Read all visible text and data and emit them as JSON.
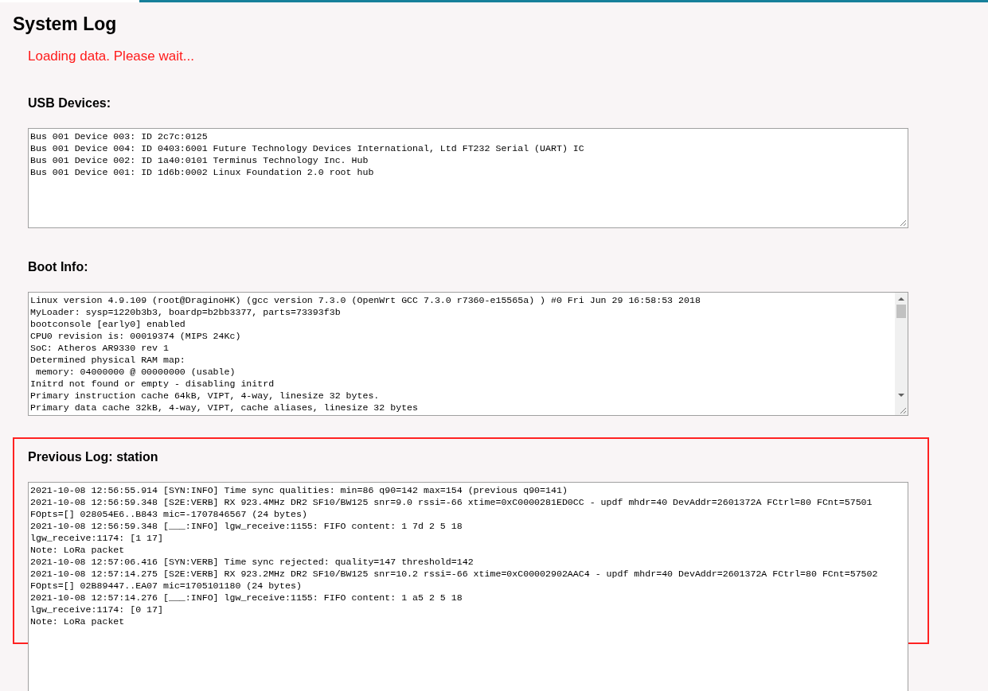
{
  "title": "System Log",
  "status": "Loading data. Please wait...",
  "sections": [
    {
      "label": "USB Devices:",
      "scrollbar": false,
      "highlighted": false,
      "lines": [
        "Bus 001 Device 003: ID 2c7c:0125",
        "Bus 001 Device 004: ID 0403:6001 Future Technology Devices International, Ltd FT232 Serial (UART) IC",
        "Bus 001 Device 002: ID 1a40:0101 Terminus Technology Inc. Hub",
        "Bus 001 Device 001: ID 1d6b:0002 Linux Foundation 2.0 root hub"
      ]
    },
    {
      "label": "Boot Info:",
      "scrollbar": true,
      "highlighted": false,
      "lines": [
        "Linux version 4.9.109 (root@DraginoHK) (gcc version 7.3.0 (OpenWrt GCC 7.3.0 r7360-e15565a) ) #0 Fri Jun 29 16:58:53 2018",
        "MyLoader: sysp=1220b3b3, boardp=b2bb3377, parts=73393f3b",
        "bootconsole [early0] enabled",
        "CPU0 revision is: 00019374 (MIPS 24Kc)",
        "SoC: Atheros AR9330 rev 1",
        "Determined physical RAM map:",
        " memory: 04000000 @ 00000000 (usable)",
        "Initrd not found or empty - disabling initrd",
        "Primary instruction cache 64kB, VIPT, 4-way, linesize 32 bytes.",
        "Primary data cache 32kB, 4-way, VIPT, cache aliases, linesize 32 bytes"
      ]
    },
    {
      "label": "Previous Log: station",
      "scrollbar": false,
      "highlighted": true,
      "lines": [
        "2021-10-08 12:56:55.914 [SYN:INFO] Time sync qualities: min=86 q90=142 max=154 (previous q90=141)",
        "2021-10-08 12:56:59.348 [S2E:VERB] RX 923.4MHz DR2 SF10/BW125 snr=9.0 rssi=-66 xtime=0xC0000281ED0CC - updf mhdr=40 DevAddr=2601372A FCtrl=80 FCnt=57501",
        "FOpts=[] 028054E6..B843 mic=-1707846567 (24 bytes)",
        "2021-10-08 12:56:59.348 [___:INFO] lgw_receive:1155: FIFO content: 1 7d 2 5 18",
        "lgw_receive:1174: [1 17]",
        "Note: LoRa packet",
        "2021-10-08 12:57:06.416 [SYN:VERB] Time sync rejected: quality=147 threshold=142",
        "2021-10-08 12:57:14.275 [S2E:VERB] RX 923.2MHz DR2 SF10/BW125 snr=10.2 rssi=-66 xtime=0xC00002902AAC4 - updf mhdr=40 DevAddr=2601372A FCtrl=80 FCnt=57502",
        "FOpts=[] 02B89447..EA07 mic=1705101180 (24 bytes)",
        "2021-10-08 12:57:14.276 [___:INFO] lgw_receive:1155: FIFO content: 1 a5 2 5 18",
        "lgw_receive:1174: [0 17]",
        "Note: LoRa packet"
      ]
    }
  ]
}
